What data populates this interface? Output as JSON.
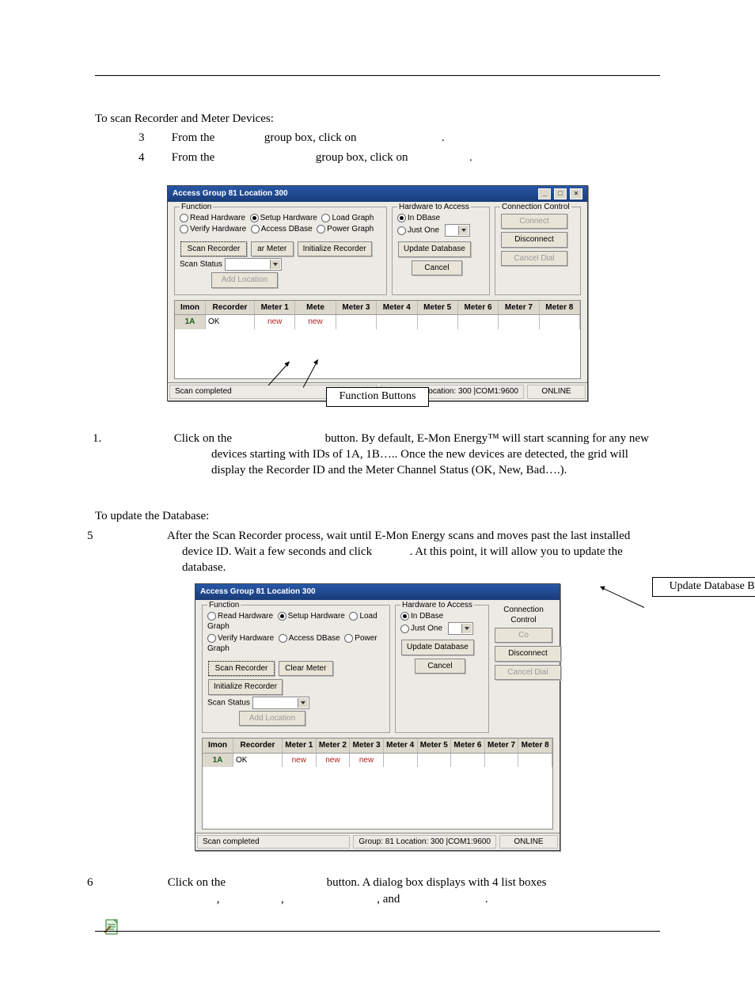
{
  "heading1": "To scan Recorder and Meter Devices:",
  "step3": {
    "num": "3",
    "before": "From the ",
    "mid1": "",
    "after1": " group box, click on ",
    "after2": "."
  },
  "step4": {
    "num": "4",
    "before": "From the ",
    "after1": " group box, click on ",
    "after2": "."
  },
  "step_scan": {
    "num": "1.",
    "text_a": "Click on the ",
    "text_b": " button. By default, E-Mon Energy™ will start scanning for any new devices starting with IDs of 1A, 1B….. Once the new devices are detected, the grid will display the Recorder ID and the Meter Channel Status (OK, New, Bad….)."
  },
  "heading2": "To update the Database:",
  "step5": {
    "num": "5",
    "text_a": "After the Scan Recorder process, wait until E-Mon Energy scans and moves past the last installed device ID.  Wait a few seconds and click ",
    "text_b": ". At this point, it will allow you to update the database."
  },
  "step6": {
    "num": "6",
    "text_a": "Click on the ",
    "text_b": " button.  A dialog box displays with 4 list boxes",
    "line2_a": ", ",
    "line2_b": ", ",
    "line2_c": ", and ",
    "line2_d": "."
  },
  "callout1": "Function Buttons",
  "callout2": "Update Database Button",
  "win": {
    "title": "Access Group 81 Location 300",
    "function": {
      "legend": "Function",
      "r1": "Read Hardware",
      "r2": "Setup Hardware",
      "r3": "Load Graph",
      "r4": "Verify Hardware",
      "r5": "Access DBase",
      "r6": "Power Graph"
    },
    "hw": {
      "legend": "Hardware to Access",
      "r1": "In DBase",
      "r2": "Just One"
    },
    "conn": {
      "legend": "Connection Control",
      "b1": "Connect",
      "b2": "Disconnect",
      "b3": "Cancel Dial"
    },
    "fn": {
      "scanrec": "Scan Recorder",
      "clearm1": "ar Meter",
      "clearm2": "Clear Meter",
      "initrec": "Initialize Recorder",
      "addloc": "Add Location",
      "upddb": "Update Database",
      "cancel": "Cancel",
      "scanstat": "Scan Status"
    },
    "grid": {
      "h": [
        "Imon",
        "Recorder",
        "Meter 1",
        "Meter 2",
        "Meter 3",
        "Meter 4",
        "Meter 5",
        "Meter 6",
        "Meter 7",
        "Meter 8"
      ],
      "row1": {
        "id": "1A",
        "rec": "OK",
        "m1": "new",
        "m2": "new",
        "m3": "new"
      },
      "meta2_cell": "Mete"
    },
    "status": {
      "s1": "Scan completed",
      "s2": "Group: 81 Location: 300 |COM1:9600",
      "s3": "ONLINE"
    }
  }
}
